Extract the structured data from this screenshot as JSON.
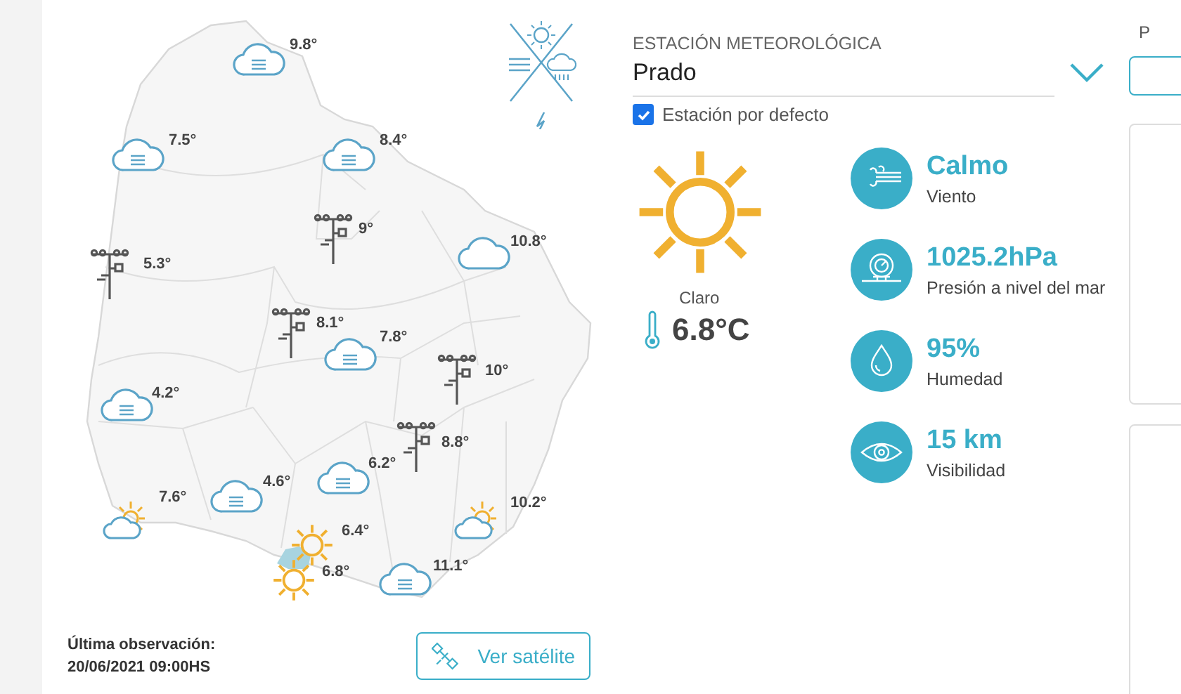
{
  "map": {
    "stations": [
      {
        "kind": "cloud",
        "temperature": "9.8°"
      },
      {
        "kind": "cloud",
        "temperature": "7.5°"
      },
      {
        "kind": "cloud",
        "temperature": "8.4°"
      },
      {
        "kind": "station",
        "temperature": "9°"
      },
      {
        "kind": "station",
        "temperature": "5.3°"
      },
      {
        "kind": "clear-cloud",
        "temperature": "10.8°"
      },
      {
        "kind": "station",
        "temperature": "8.1°"
      },
      {
        "kind": "cloud",
        "temperature": "7.8°"
      },
      {
        "kind": "station",
        "temperature": "10°"
      },
      {
        "kind": "cloud",
        "temperature": "4.2°"
      },
      {
        "kind": "station",
        "temperature": "8.8°"
      },
      {
        "kind": "cloud",
        "temperature": "6.2°"
      },
      {
        "kind": "cloud",
        "temperature": "4.6°"
      },
      {
        "kind": "cloud-sun",
        "temperature": "7.6°"
      },
      {
        "kind": "cloud-sun",
        "temperature": "10.2°"
      },
      {
        "kind": "sun",
        "temperature": "6.4°"
      },
      {
        "kind": "sun",
        "temperature": "6.8°"
      },
      {
        "kind": "cloud",
        "temperature": "11.1°"
      }
    ]
  },
  "last_observation": {
    "label": "Última observación:",
    "value": "20/06/2021 09:00HS"
  },
  "satellite_button": "Ver satélite",
  "station_select": {
    "label": "ESTACIÓN METEOROLÓGICA",
    "value": "Prado"
  },
  "default_checkbox": {
    "label": "Estación por defecto",
    "checked": true
  },
  "current": {
    "condition": "Claro",
    "temperature": "6.8°C"
  },
  "metrics": [
    {
      "kind": "wind",
      "value": "Calmo",
      "label": "Viento"
    },
    {
      "kind": "pressure",
      "value": "1025.2hPa",
      "label": "Presión a nivel del mar"
    },
    {
      "kind": "humidity",
      "value": "95%",
      "label": "Humedad"
    },
    {
      "kind": "visibility",
      "value": "15 km",
      "label": "Visibilidad"
    }
  ],
  "side_panel": {
    "label": "P"
  }
}
